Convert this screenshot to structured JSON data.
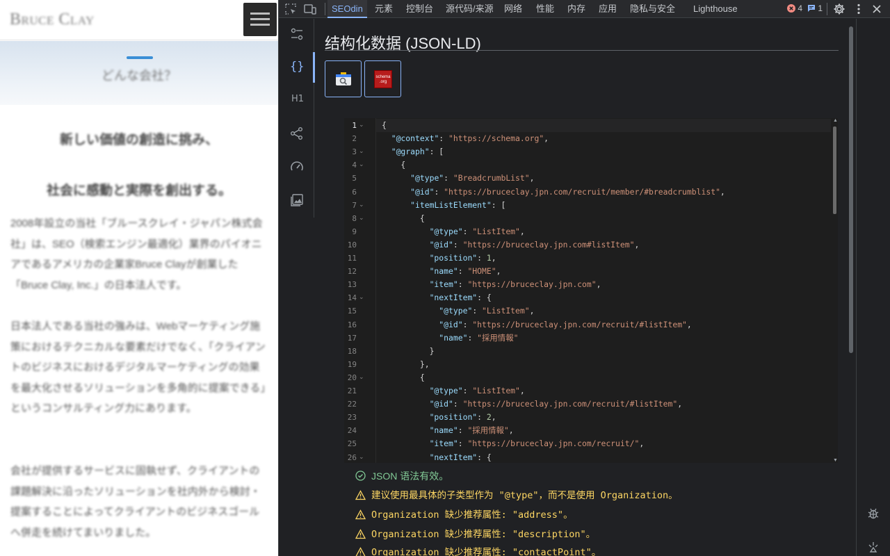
{
  "page": {
    "logo": "Bruce Clay",
    "hero_question": "どんな会社？",
    "heading_1": "新しい価値の創造に挑み、",
    "heading_2": "社会に感動と実際を創出する。",
    "paragraph_1": "2008年設立の当社「ブルースクレイ・ジャパン株式会社」は、SEO（検索エンジン最適化）業界のパイオニアであるアメリカの企業家Bruce Clayが創業した「Bruce Clay, Inc.」の日本法人です。",
    "paragraph_2": "日本法人である当社の強みは、Webマーケティング施策におけるテクニカルな要素だけでなく、「クライアントのビジネスにおけるデジタルマーケティングの効果を最大化させるソリューションを多角的に提案できる」というコンサルティング力にあります。",
    "paragraph_3": "会社が提供するサービスに固執せず、クライアントの課題解決に沿ったソリューションを社内外から検討・提案することによってクライアントのビジネスゴールへ併走を続けてまいりました。"
  },
  "devtools": {
    "tabs": [
      "SEOdin",
      "元素",
      "控制台",
      "源代码/来源",
      "网络",
      "性能",
      "内存",
      "应用",
      "隐私与安全",
      "Lighthouse"
    ],
    "error_count": "4",
    "message_count": "1",
    "sidebar_h_label": "H1",
    "panel_title": "结构化数据 (JSON-LD)",
    "schema_logo_text": "schema\n.org",
    "code_lines": [
      [
        [
          "p",
          "{"
        ]
      ],
      [
        [
          "p",
          "  "
        ],
        [
          "k",
          "\"@context\""
        ],
        [
          "p",
          ": "
        ],
        [
          "s",
          "\"https://schema.org\""
        ],
        [
          "p",
          ","
        ]
      ],
      [
        [
          "p",
          "  "
        ],
        [
          "k",
          "\"@graph\""
        ],
        [
          "p",
          ": ["
        ]
      ],
      [
        [
          "p",
          "    {"
        ]
      ],
      [
        [
          "p",
          "      "
        ],
        [
          "k",
          "\"@type\""
        ],
        [
          "p",
          ": "
        ],
        [
          "s",
          "\"BreadcrumbList\""
        ],
        [
          "p",
          ","
        ]
      ],
      [
        [
          "p",
          "      "
        ],
        [
          "k",
          "\"@id\""
        ],
        [
          "p",
          ": "
        ],
        [
          "s",
          "\"https://bruceclay.jpn.com/recruit/member/#breadcrumblist\""
        ],
        [
          "p",
          ","
        ]
      ],
      [
        [
          "p",
          "      "
        ],
        [
          "k",
          "\"itemListElement\""
        ],
        [
          "p",
          ": ["
        ]
      ],
      [
        [
          "p",
          "        {"
        ]
      ],
      [
        [
          "p",
          "          "
        ],
        [
          "k",
          "\"@type\""
        ],
        [
          "p",
          ": "
        ],
        [
          "s",
          "\"ListItem\""
        ],
        [
          "p",
          ","
        ]
      ],
      [
        [
          "p",
          "          "
        ],
        [
          "k",
          "\"@id\""
        ],
        [
          "p",
          ": "
        ],
        [
          "s",
          "\"https://bruceclay.jpn.com#listItem\""
        ],
        [
          "p",
          ","
        ]
      ],
      [
        [
          "p",
          "          "
        ],
        [
          "k",
          "\"position\""
        ],
        [
          "p",
          ": "
        ],
        [
          "n",
          "1"
        ],
        [
          "p",
          ","
        ]
      ],
      [
        [
          "p",
          "          "
        ],
        [
          "k",
          "\"name\""
        ],
        [
          "p",
          ": "
        ],
        [
          "s",
          "\"HOME\""
        ],
        [
          "p",
          ","
        ]
      ],
      [
        [
          "p",
          "          "
        ],
        [
          "k",
          "\"item\""
        ],
        [
          "p",
          ": "
        ],
        [
          "s",
          "\"https://bruceclay.jpn.com\""
        ],
        [
          "p",
          ","
        ]
      ],
      [
        [
          "p",
          "          "
        ],
        [
          "k",
          "\"nextItem\""
        ],
        [
          "p",
          ": {"
        ]
      ],
      [
        [
          "p",
          "            "
        ],
        [
          "k",
          "\"@type\""
        ],
        [
          "p",
          ": "
        ],
        [
          "s",
          "\"ListItem\""
        ],
        [
          "p",
          ","
        ]
      ],
      [
        [
          "p",
          "            "
        ],
        [
          "k",
          "\"@id\""
        ],
        [
          "p",
          ": "
        ],
        [
          "s",
          "\"https://bruceclay.jpn.com/recruit/#listItem\""
        ],
        [
          "p",
          ","
        ]
      ],
      [
        [
          "p",
          "            "
        ],
        [
          "k",
          "\"name\""
        ],
        [
          "p",
          ": "
        ],
        [
          "s",
          "\"採用情報\""
        ]
      ],
      [
        [
          "p",
          "          }"
        ]
      ],
      [
        [
          "p",
          "        },"
        ]
      ],
      [
        [
          "p",
          "        {"
        ]
      ],
      [
        [
          "p",
          "          "
        ],
        [
          "k",
          "\"@type\""
        ],
        [
          "p",
          ": "
        ],
        [
          "s",
          "\"ListItem\""
        ],
        [
          "p",
          ","
        ]
      ],
      [
        [
          "p",
          "          "
        ],
        [
          "k",
          "\"@id\""
        ],
        [
          "p",
          ": "
        ],
        [
          "s",
          "\"https://bruceclay.jpn.com/recruit/#listItem\""
        ],
        [
          "p",
          ","
        ]
      ],
      [
        [
          "p",
          "          "
        ],
        [
          "k",
          "\"position\""
        ],
        [
          "p",
          ": "
        ],
        [
          "n",
          "2"
        ],
        [
          "p",
          ","
        ]
      ],
      [
        [
          "p",
          "          "
        ],
        [
          "k",
          "\"name\""
        ],
        [
          "p",
          ": "
        ],
        [
          "s",
          "\"採用情報\""
        ],
        [
          "p",
          ","
        ]
      ],
      [
        [
          "p",
          "          "
        ],
        [
          "k",
          "\"item\""
        ],
        [
          "p",
          ": "
        ],
        [
          "s",
          "\"https://bruceclay.jpn.com/recruit/\""
        ],
        [
          "p",
          ","
        ]
      ],
      [
        [
          "p",
          "          "
        ],
        [
          "k",
          "\"nextItem\""
        ],
        [
          "p",
          ": {"
        ]
      ]
    ],
    "fold_lines": [
      1,
      3,
      4,
      7,
      8,
      14,
      20,
      26
    ],
    "validation": {
      "ok": "JSON 语法有效。",
      "warnings": [
        "建议使用最具体的子类型作为 \"@type\"，而不是使用 Organization。",
        "Organization 缺少推荐属性: \"address\"。",
        "Organization 缺少推荐属性: \"description\"。",
        "Organization 缺少推荐属性: \"contactPoint\"。"
      ]
    },
    "colors": {
      "accent": "#8ab4f8",
      "ok": "#81c995",
      "warn": "#fdd663",
      "error": "#f28b82"
    }
  }
}
